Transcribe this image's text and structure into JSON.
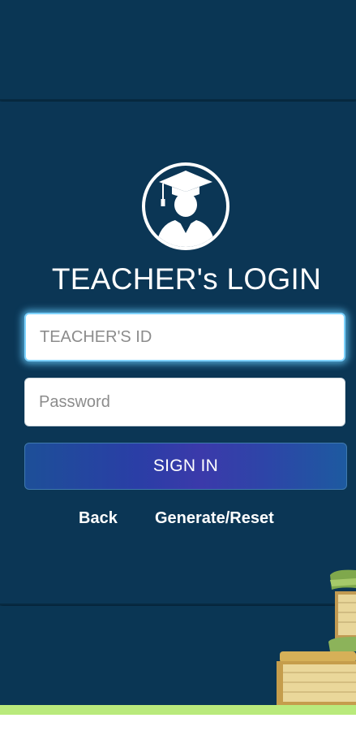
{
  "login": {
    "title": "TEACHER's LOGIN",
    "teacher_id": {
      "placeholder": "TEACHER'S ID",
      "value": ""
    },
    "password": {
      "placeholder": "Password",
      "value": ""
    },
    "signin_label": "SIGN IN",
    "back_label": "Back",
    "generate_reset_label": "Generate/Reset"
  },
  "icons": {
    "avatar": "graduate-avatar-icon",
    "decoration": "books-stack-icon"
  },
  "colors": {
    "background": "#0a3654",
    "focus_glow": "#7fd3ff",
    "signin_gradient": [
      "#1d4f98",
      "#3b3aaa",
      "#1d5aa0"
    ],
    "accent_strip": "#b9ea7c"
  }
}
